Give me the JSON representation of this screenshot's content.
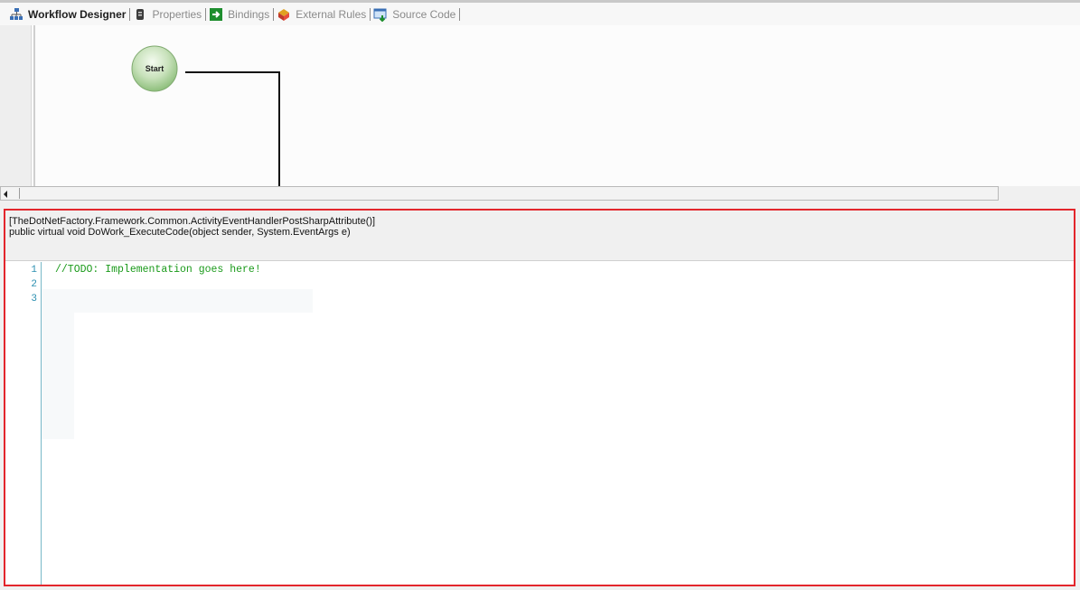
{
  "tabs": [
    {
      "label": "Workflow Designer",
      "icon": "workflow-icon",
      "active": true
    },
    {
      "label": "Properties",
      "icon": "properties-icon",
      "active": false
    },
    {
      "label": "Bindings",
      "icon": "bindings-icon",
      "active": false
    },
    {
      "label": "External Rules",
      "icon": "external-rules-icon",
      "active": false
    },
    {
      "label": "Source Code",
      "icon": "source-code-icon",
      "active": false
    }
  ],
  "designer": {
    "start_node_label": "Start"
  },
  "code": {
    "signature_line1": "[TheDotNetFactory.Framework.Common.ActivityEventHandlerPostSharpAttribute()]",
    "signature_line2": "public virtual void DoWork_ExecuteCode(object sender, System.EventArgs e)",
    "line_numbers": [
      "1",
      "2",
      "3"
    ],
    "lines": [
      "//TODO: Implementation goes here!",
      "",
      ""
    ]
  },
  "colors": {
    "highlight_border": "#e3262c",
    "comment_green": "#1a9a1a",
    "line_number_blue": "#2b8fb0"
  }
}
